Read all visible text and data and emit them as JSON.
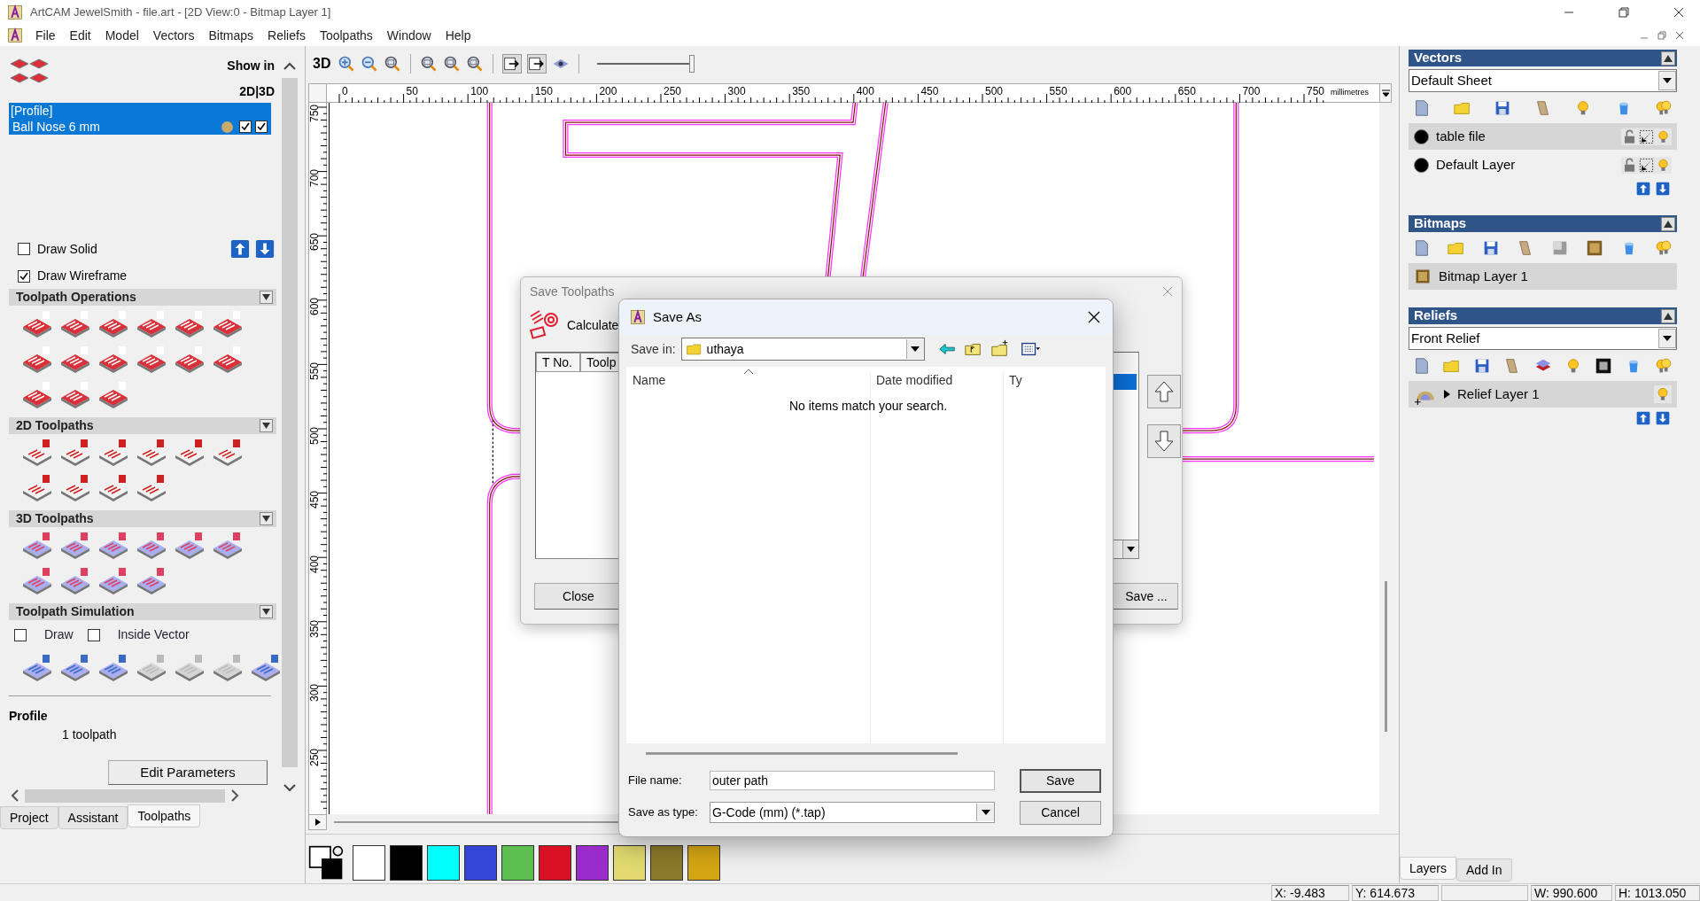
{
  "window": {
    "title": "ArtCAM JewelSmith - file.art - [2D View:0 - Bitmap Layer 1]"
  },
  "menu": [
    "File",
    "Edit",
    "Model",
    "Vectors",
    "Bitmaps",
    "Reliefs",
    "Toolpaths",
    "Window",
    "Help"
  ],
  "left_panel": {
    "show_in_label": "Show in",
    "show_in_modes": "2D|3D",
    "toolpath_group": {
      "name": "[Profile]",
      "tool": "Ball Nose 6 mm",
      "selected": true,
      "show_2d": true,
      "show_3d": true
    },
    "options": [
      {
        "label": "Draw Solid",
        "checked": false
      },
      {
        "label": "Draw Wireframe",
        "checked": true
      }
    ],
    "sections": [
      {
        "title": "Toolpath Operations"
      },
      {
        "title": "2D Toolpaths"
      },
      {
        "title": "3D Toolpaths"
      },
      {
        "title": "Toolpath Simulation"
      }
    ],
    "simulation_options": [
      {
        "label": "Draw",
        "checked": false
      },
      {
        "label": "Inside Vector",
        "checked": false
      }
    ],
    "summary": {
      "title": "Profile",
      "detail": "1 toolpath"
    },
    "edit_button": "Edit Parameters",
    "tabs": [
      {
        "label": "Project",
        "selected": false
      },
      {
        "label": "Assistant",
        "selected": false
      },
      {
        "label": "Toolpaths",
        "selected": true
      }
    ]
  },
  "view_toolbar": {
    "mode_label": "3D",
    "zoom_slider": {
      "level": 1
    }
  },
  "ruler": {
    "x_labels": [
      "0",
      "50",
      "100",
      "150",
      "200",
      "250",
      "300",
      "350",
      "400",
      "450",
      "500",
      "550",
      "600",
      "650",
      "700",
      "750"
    ],
    "unit": "millimetres",
    "y_labels": [
      "750",
      "700",
      "650",
      "600",
      "550",
      "500",
      "450",
      "400",
      "350",
      "300",
      "250"
    ]
  },
  "save_toolpaths_dialog": {
    "title": "Save Toolpaths",
    "label": "Calculate",
    "columns": [
      "T No.",
      "Toolp"
    ],
    "close_button": "Close",
    "save_button": "Save ..."
  },
  "save_as_dialog": {
    "title": "Save As",
    "save_in_label": "Save in:",
    "save_in_value": "uthaya",
    "columns": [
      "Name",
      "Date modified",
      "Ty"
    ],
    "empty_message": "No items match your search.",
    "file_name_label": "File name:",
    "file_name": "outer path",
    "type_label": "Save as type:",
    "type_value": "G-Code (mm) (*.tap)",
    "save_button": "Save",
    "cancel_button": "Cancel"
  },
  "palette": [
    {
      "color": "#ffffff"
    },
    {
      "color": "#000000"
    },
    {
      "color": "#00ffff"
    },
    {
      "color": "#3446d8"
    },
    {
      "color": "#5cbf4f"
    },
    {
      "color": "#d91022"
    },
    {
      "color": "#9a2ccc"
    },
    {
      "color": "#e2da70"
    },
    {
      "color": "#8a7a2a"
    },
    {
      "color": "#d4a614"
    }
  ],
  "right_panel": {
    "vectors": {
      "title": "Vectors",
      "sheet": "Default Sheet",
      "layers": [
        {
          "name": "table file",
          "selected": true
        },
        {
          "name": "Default Layer",
          "selected": false
        }
      ]
    },
    "bitmaps": {
      "title": "Bitmaps",
      "layers": [
        {
          "name": "Bitmap Layer 1",
          "selected": true
        }
      ]
    },
    "reliefs": {
      "title": "Reliefs",
      "sheet": "Front Relief",
      "layers": [
        {
          "name": "Relief Layer 1",
          "selected": true
        }
      ]
    },
    "tabs": [
      {
        "label": "Layers",
        "selected": true
      },
      {
        "label": "Add In",
        "selected": false
      }
    ]
  },
  "status_bar": [
    "X: -9.483",
    "Y: 614.673",
    "W: 990.600",
    "H: 1013.050"
  ]
}
